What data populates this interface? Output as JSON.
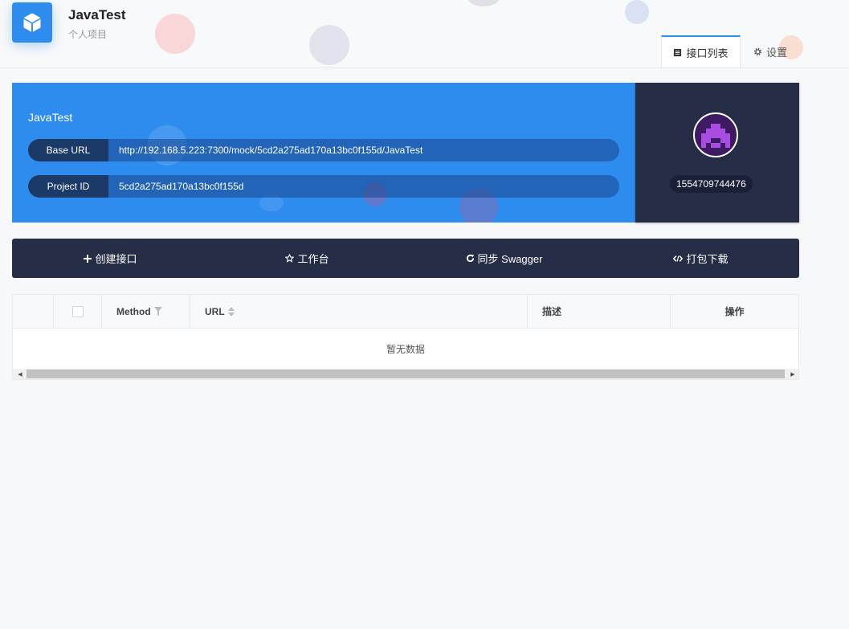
{
  "project": {
    "name": "JavaTest",
    "subtitle": "个人项目"
  },
  "tabs": [
    {
      "label": "接口列表",
      "icon": "list-icon",
      "active": true
    },
    {
      "label": "设置",
      "icon": "gear-icon",
      "active": false
    }
  ],
  "banner": {
    "title": "JavaTest",
    "base_url": {
      "label": "Base URL",
      "value": "http://192.168.5.223:7300/mock/5cd2a275ad170a13bc0f155d/JavaTest"
    },
    "project_id": {
      "label": "Project ID",
      "value": "5cd2a275ad170a13bc0f155d"
    }
  },
  "owner": {
    "id": "1554709744476"
  },
  "actions": [
    {
      "label": "创建接口",
      "icon": "plus-icon"
    },
    {
      "label": "工作台",
      "icon": "star-icon"
    },
    {
      "label": "同步 Swagger",
      "icon": "sync-icon"
    },
    {
      "label": "打包下载",
      "icon": "code-icon"
    }
  ],
  "table": {
    "columns": {
      "method": "Method",
      "url": "URL",
      "description": "描述",
      "operations": "操作"
    },
    "empty_text": "暂无数据"
  },
  "colors": {
    "primary": "#2f8cef",
    "dark": "#252d47"
  }
}
